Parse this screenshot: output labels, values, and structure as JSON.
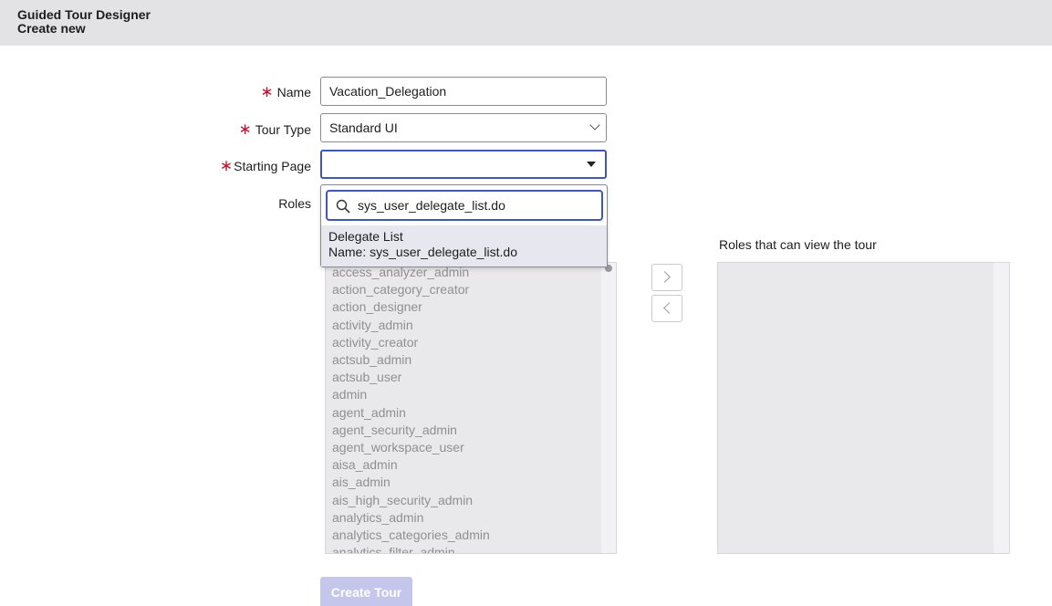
{
  "header": {
    "title": "Guided Tour Designer",
    "subtitle": "Create new"
  },
  "form": {
    "name_label": "Name",
    "name_value": "Vacation_Delegation",
    "tour_type_label": "Tour Type",
    "tour_type_value": "Standard UI",
    "starting_page_label": "Starting Page",
    "starting_page_value": "",
    "roles_label": "Roles",
    "required_marker": "∗"
  },
  "dropdown": {
    "search_value": "sys_user_delegate_list.do",
    "option_title": "Delegate List",
    "option_detail": "Name: sys_user_delegate_list.do"
  },
  "roles": {
    "available": [
      "access_analyzer_admin",
      "action_category_creator",
      "action_designer",
      "activity_admin",
      "activity_creator",
      "actsub_admin",
      "actsub_user",
      "admin",
      "agent_admin",
      "agent_security_admin",
      "agent_workspace_user",
      "aisa_admin",
      "ais_admin",
      "ais_high_security_admin",
      "analytics_admin",
      "analytics_categories_admin",
      "analytics_filter_admin"
    ],
    "selected_title": "Roles that can view the tour"
  },
  "buttons": {
    "create_tour": "Create Tour"
  },
  "colors": {
    "required": "#c8102e",
    "focus_border": "#3c56c2",
    "primary_disabled": "#c5c6eb"
  }
}
